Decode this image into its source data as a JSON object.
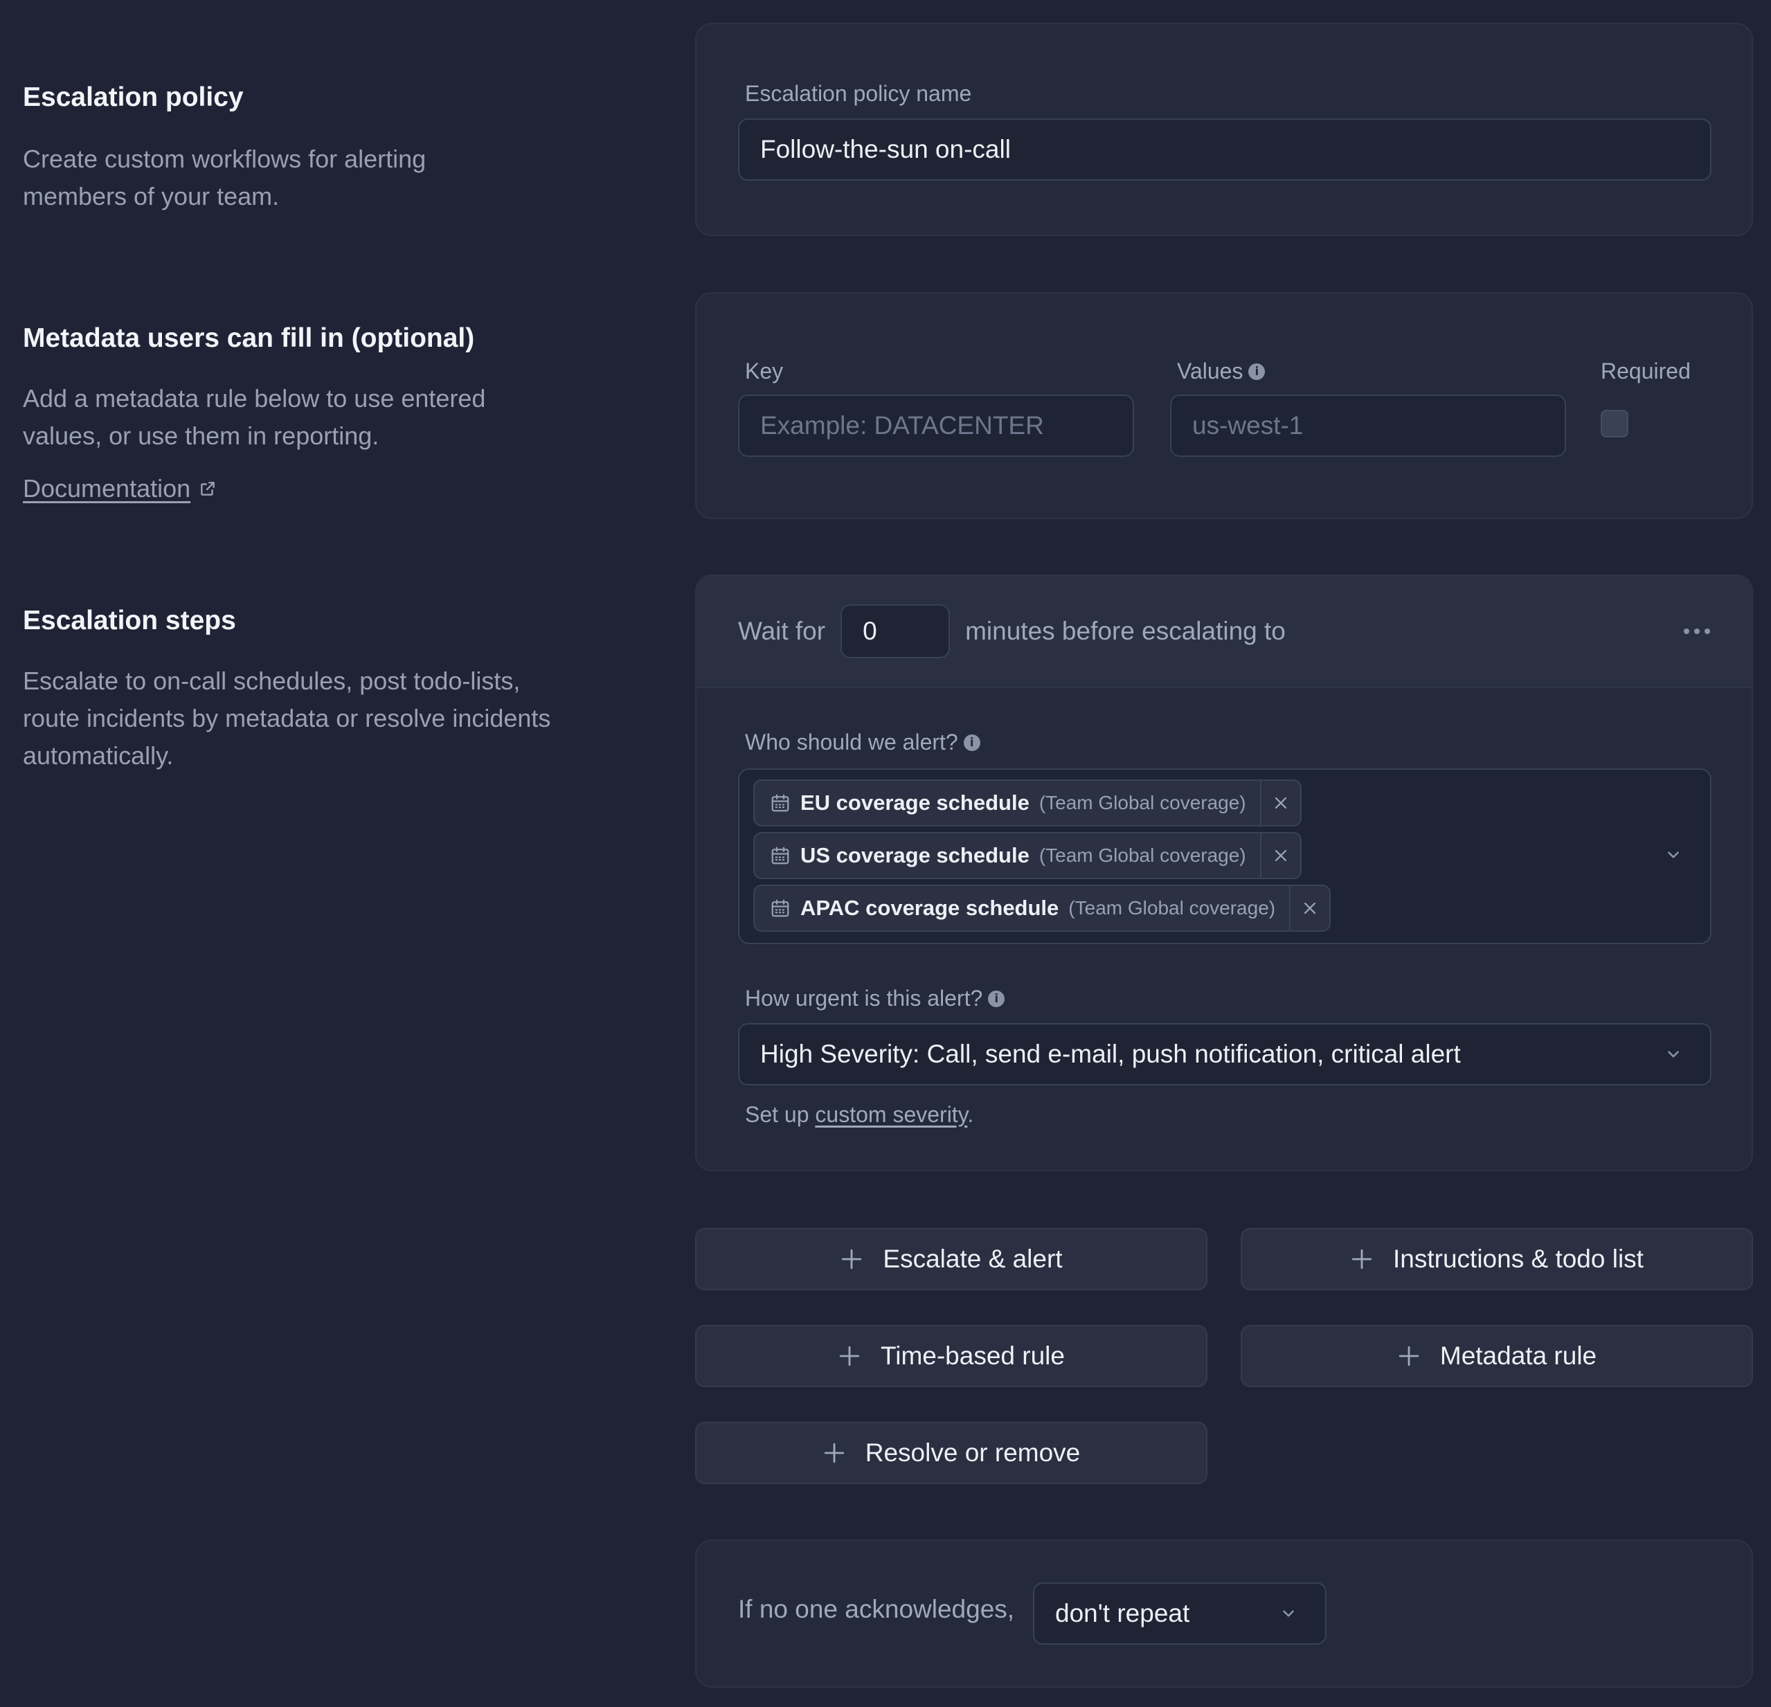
{
  "policy_section": {
    "title": "Escalation policy",
    "description": "Create custom workflows for alerting members of your team.",
    "name_label": "Escalation policy name",
    "name_value": "Follow-the-sun on-call"
  },
  "metadata_section": {
    "title": "Metadata users can fill in (optional)",
    "description": "Add a metadata rule below to use entered values, or use them in reporting.",
    "doc_link": "Documentation",
    "key_label": "Key",
    "key_placeholder": "Example: DATACENTER",
    "values_label": "Values",
    "values_placeholder": "us-west-1",
    "required_label": "Required",
    "required_checked": false
  },
  "steps_section": {
    "title": "Escalation steps",
    "description": "Escalate to on-call schedules, post todo-lists, route incidents by metadata or resolve incidents automatically.",
    "wait_prefix": "Wait for",
    "wait_value": "0",
    "wait_suffix": "minutes before escalating to",
    "who_label": "Who should we alert?",
    "targets": [
      {
        "name": "EU coverage schedule",
        "team": "(Team Global coverage)",
        "icon": "calendar-icon"
      },
      {
        "name": "US coverage schedule",
        "team": "(Team Global coverage)",
        "icon": "calendar-icon"
      },
      {
        "name": "APAC coverage schedule",
        "team": "(Team Global coverage)",
        "icon": "calendar-icon"
      }
    ],
    "urgency_label": "How urgent is this alert?",
    "urgency_value": "High Severity: Call, send e-mail, push notification, critical alert",
    "setup_prefix": "Set up",
    "setup_link": "custom severity",
    "setup_suffix": "."
  },
  "actions": {
    "escalate_alert": "Escalate & alert",
    "instructions_todo": "Instructions & todo list",
    "time_based_rule": "Time-based rule",
    "metadata_rule": "Metadata rule",
    "resolve_remove": "Resolve or remove"
  },
  "repeat": {
    "prefix": "If no one acknowledges,",
    "value": "don't repeat"
  },
  "colors": {
    "background": "#1f2335",
    "card": "#242a3b",
    "input": "#1f2435",
    "muted_text": "#9aa0b4"
  }
}
